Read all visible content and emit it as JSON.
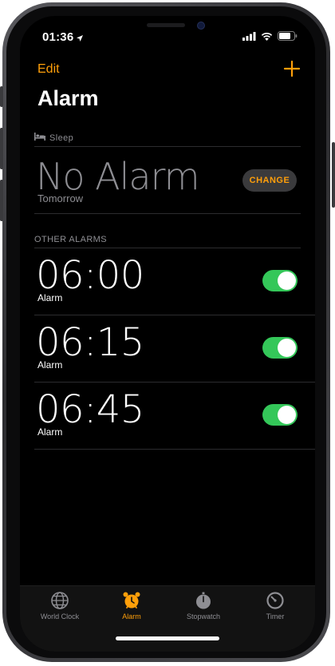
{
  "status_bar": {
    "time": "01:36",
    "icons": [
      "location-arrow-icon",
      "cellular-signal-icon",
      "wifi-icon",
      "battery-icon"
    ]
  },
  "nav": {
    "edit_label": "Edit",
    "add_icon": "plus-icon"
  },
  "page": {
    "title": "Alarm"
  },
  "sleep": {
    "section_label": "Sleep",
    "icon": "bed-icon",
    "status": "No Alarm",
    "subtitle": "Tomorrow",
    "change_label": "CHANGE"
  },
  "other_alarms": {
    "section_label": "OTHER ALARMS",
    "items": [
      {
        "time": "06:00",
        "label": "Alarm",
        "enabled": true
      },
      {
        "time": "06:15",
        "label": "Alarm",
        "enabled": true
      },
      {
        "time": "06:45",
        "label": "Alarm",
        "enabled": true
      }
    ]
  },
  "tab_bar": {
    "active": "Alarm",
    "tabs": [
      {
        "label": "World Clock",
        "icon": "globe-icon"
      },
      {
        "label": "Alarm",
        "icon": "alarm-clock-icon"
      },
      {
        "label": "Stopwatch",
        "icon": "stopwatch-icon"
      },
      {
        "label": "Timer",
        "icon": "timer-icon"
      }
    ]
  },
  "colors": {
    "accent": "#ff9f0a",
    "toggle_on": "#34c759",
    "background": "#000000",
    "secondary_text": "#8e8e93"
  }
}
